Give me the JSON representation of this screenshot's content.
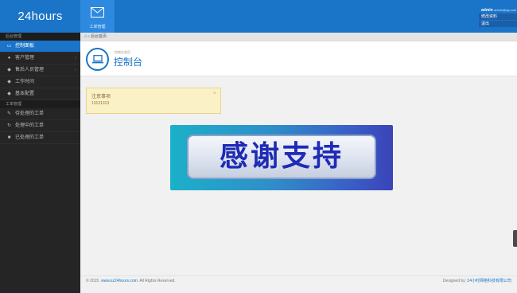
{
  "app": {
    "logo": "24hours"
  },
  "topnav": {
    "tab_label": "工单管理"
  },
  "user": {
    "name": "admin",
    "sub": "admin@qq.com",
    "menu": [
      "修改资料",
      "退出"
    ]
  },
  "sidebar": {
    "groups": [
      {
        "title": "后台管理",
        "items": [
          {
            "label": "控制面板",
            "icon": "laptop-icon",
            "active": true
          },
          {
            "label": "客户管理",
            "icon": "user-icon",
            "has_children": true
          },
          {
            "label": "售后人员管理",
            "icon": "chat-icon",
            "has_children": true
          },
          {
            "label": "工作时间",
            "icon": "chat-icon"
          },
          {
            "label": "基本配置",
            "icon": "chat-icon"
          }
        ]
      },
      {
        "title": "工单管理",
        "items": [
          {
            "label": "待处理的工单",
            "icon": "pencil-icon"
          },
          {
            "label": "处理中的工单",
            "icon": "refresh-icon"
          },
          {
            "label": "已处理的工单",
            "icon": "briefcase-icon"
          }
        ]
      }
    ]
  },
  "breadcrumb": {
    "current": "后台首页"
  },
  "page": {
    "subtitle": "控制台首页",
    "title": "控制台"
  },
  "notice": {
    "title": "注意事项",
    "body": "13131313"
  },
  "banner": {
    "text": "感谢支持"
  },
  "footer": {
    "left_prefix": "© 2015.",
    "left_link": "www.sz24hours.com",
    "left_suffix": ". All Rights Reserved.",
    "right_prefix": "Designed by:",
    "right_link": "24小时网络科技有限公司"
  },
  "colors": {
    "primary": "#1a74c8",
    "sidebar": "#252525"
  }
}
